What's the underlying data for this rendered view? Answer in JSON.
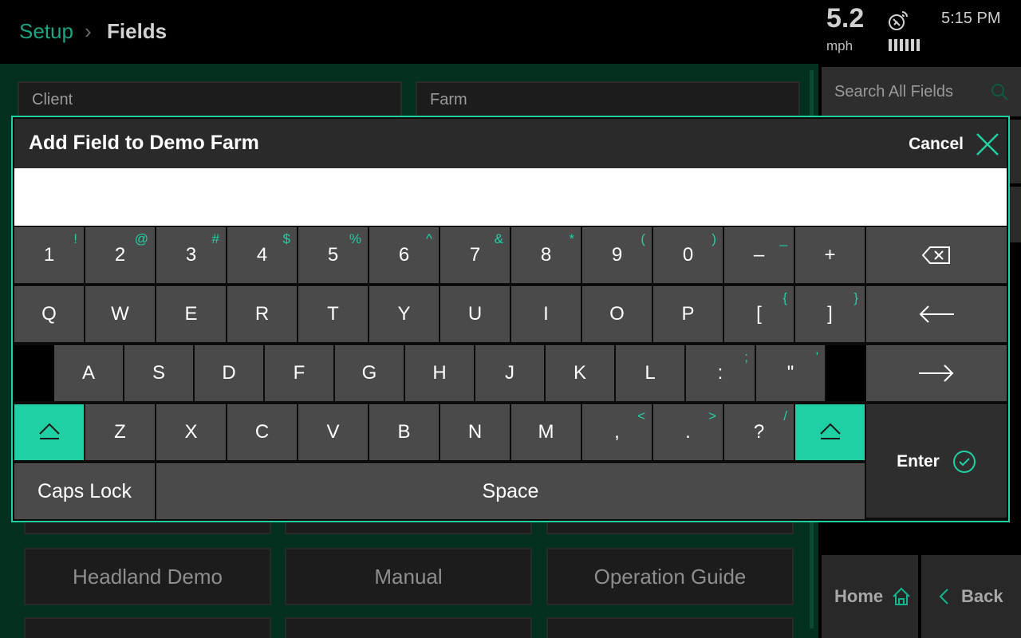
{
  "header": {
    "breadcrumb_parent": "Setup",
    "breadcrumb_separator": "›",
    "breadcrumb_current": "Fields",
    "speed_value": "5.2",
    "speed_unit": "mph",
    "time": "5:15 PM",
    "gps_icon": "satellite-signal-icon"
  },
  "background": {
    "client_label": "Client",
    "farm_label": "Farm",
    "search_placeholder": "Search All Fields",
    "tiles": [
      "Headland Demo",
      "Manual",
      "Operation Guide"
    ],
    "nav": {
      "home_label": "Home",
      "back_label": "Back"
    }
  },
  "modal": {
    "title": "Add Field to Demo Farm",
    "cancel_label": "Cancel",
    "input_value": "",
    "keyboard": {
      "row1": [
        {
          "main": "1",
          "alt": "!"
        },
        {
          "main": "2",
          "alt": "@"
        },
        {
          "main": "3",
          "alt": "#"
        },
        {
          "main": "4",
          "alt": "$"
        },
        {
          "main": "5",
          "alt": "%"
        },
        {
          "main": "6",
          "alt": "^"
        },
        {
          "main": "7",
          "alt": "&"
        },
        {
          "main": "8",
          "alt": "*"
        },
        {
          "main": "9",
          "alt": "("
        },
        {
          "main": "0",
          "alt": ")"
        },
        {
          "main": "–",
          "alt": "_"
        },
        {
          "main": "+",
          "alt": ""
        }
      ],
      "row2": [
        {
          "main": "Q",
          "alt": ""
        },
        {
          "main": "W",
          "alt": ""
        },
        {
          "main": "E",
          "alt": ""
        },
        {
          "main": "R",
          "alt": ""
        },
        {
          "main": "T",
          "alt": ""
        },
        {
          "main": "Y",
          "alt": ""
        },
        {
          "main": "U",
          "alt": ""
        },
        {
          "main": "I",
          "alt": ""
        },
        {
          "main": "O",
          "alt": ""
        },
        {
          "main": "P",
          "alt": ""
        },
        {
          "main": "[",
          "alt": "{"
        },
        {
          "main": "]",
          "alt": "}"
        }
      ],
      "row3": [
        {
          "main": "A",
          "alt": ""
        },
        {
          "main": "S",
          "alt": ""
        },
        {
          "main": "D",
          "alt": ""
        },
        {
          "main": "F",
          "alt": ""
        },
        {
          "main": "G",
          "alt": ""
        },
        {
          "main": "H",
          "alt": ""
        },
        {
          "main": "J",
          "alt": ""
        },
        {
          "main": "K",
          "alt": ""
        },
        {
          "main": "L",
          "alt": ""
        },
        {
          "main": ":",
          "alt": ";"
        },
        {
          "main": "\"",
          "alt": "'"
        }
      ],
      "row4": [
        {
          "main": "Z",
          "alt": ""
        },
        {
          "main": "X",
          "alt": ""
        },
        {
          "main": "C",
          "alt": ""
        },
        {
          "main": "V",
          "alt": ""
        },
        {
          "main": "B",
          "alt": ""
        },
        {
          "main": "N",
          "alt": ""
        },
        {
          "main": "M",
          "alt": ""
        },
        {
          "main": ",",
          "alt": "<"
        },
        {
          "main": ".",
          "alt": ">"
        },
        {
          "main": "?",
          "alt": "/"
        }
      ],
      "caps_lock_label": "Caps Lock",
      "space_label": "Space",
      "enter_label": "Enter",
      "backspace_icon": "backspace-icon",
      "left_arrow_icon": "arrow-left-icon",
      "right_arrow_icon": "arrow-right-icon",
      "shift_icon": "shift-icon"
    }
  },
  "colors": {
    "accent": "#1fd0a4",
    "breadcrumb_green": "#1aa582",
    "background_green": "#04311f",
    "key_gray": "#4a4a4a",
    "header_gray": "#2a2a2a"
  }
}
